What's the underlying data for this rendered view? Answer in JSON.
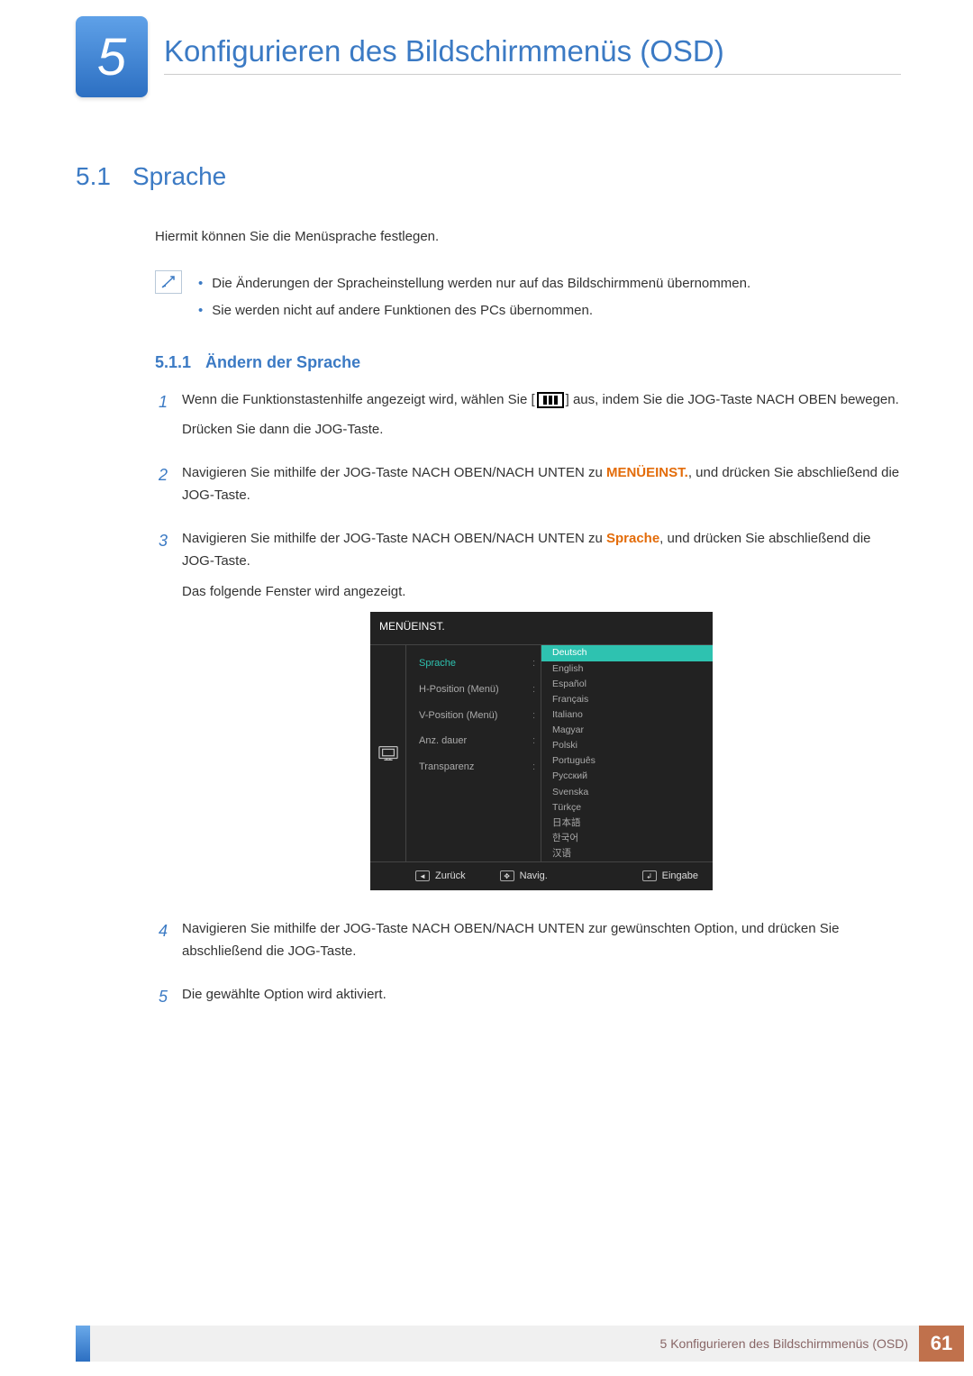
{
  "chapter": {
    "number": "5",
    "title": "Konfigurieren des Bildschirmmenüs (OSD)"
  },
  "section": {
    "number": "5.1",
    "title": "Sprache",
    "intro": "Hiermit können Sie die Menüsprache festlegen.",
    "notes": [
      "Die Änderungen der Spracheinstellung werden nur auf das Bildschirmmenü übernommen.",
      "Sie werden nicht auf andere Funktionen des PCs übernommen."
    ]
  },
  "subsection": {
    "number": "5.1.1",
    "title": "Ändern der Sprache"
  },
  "steps": {
    "s1a_pre": "Wenn die Funktionstastenhilfe angezeigt wird, wählen Sie [",
    "s1a_post": "] aus, indem Sie die JOG-Taste NACH OBEN bewegen.",
    "s1b": "Drücken Sie dann die JOG-Taste.",
    "s2_pre": "Navigieren Sie mithilfe der JOG-Taste NACH OBEN/NACH UNTEN zu ",
    "s2_hl": "MENÜEINST.",
    "s2_post": ", und drücken Sie abschließend die JOG-Taste.",
    "s3_pre": "Navigieren Sie mithilfe der JOG-Taste NACH OBEN/NACH UNTEN zu ",
    "s3_hl": "Sprache",
    "s3_post": ", und drücken Sie abschließend die JOG-Taste.",
    "s3_extra": "Das folgende Fenster wird angezeigt.",
    "s4": "Navigieren Sie mithilfe der JOG-Taste NACH OBEN/NACH UNTEN zur gewünschten Option, und drücken Sie abschließend die JOG-Taste.",
    "s5": "Die gewählte Option wird aktiviert."
  },
  "osd": {
    "title": "MENÜEINST.",
    "left": [
      "Sprache",
      "H-Position (Menü)",
      "V-Position (Menü)",
      "Anz. dauer",
      "Transparenz"
    ],
    "right": [
      "Deutsch",
      "English",
      "Español",
      "Français",
      "Italiano",
      "Magyar",
      "Polski",
      "Português",
      "Русский",
      "Svenska",
      "Türkçe",
      "日本語",
      "한국어",
      "汉语"
    ],
    "footer": {
      "back": "Zurück",
      "nav": "Navig.",
      "enter": "Eingabe"
    }
  },
  "footer": {
    "text": "5 Konfigurieren des Bildschirmmenüs (OSD)",
    "page": "61"
  }
}
